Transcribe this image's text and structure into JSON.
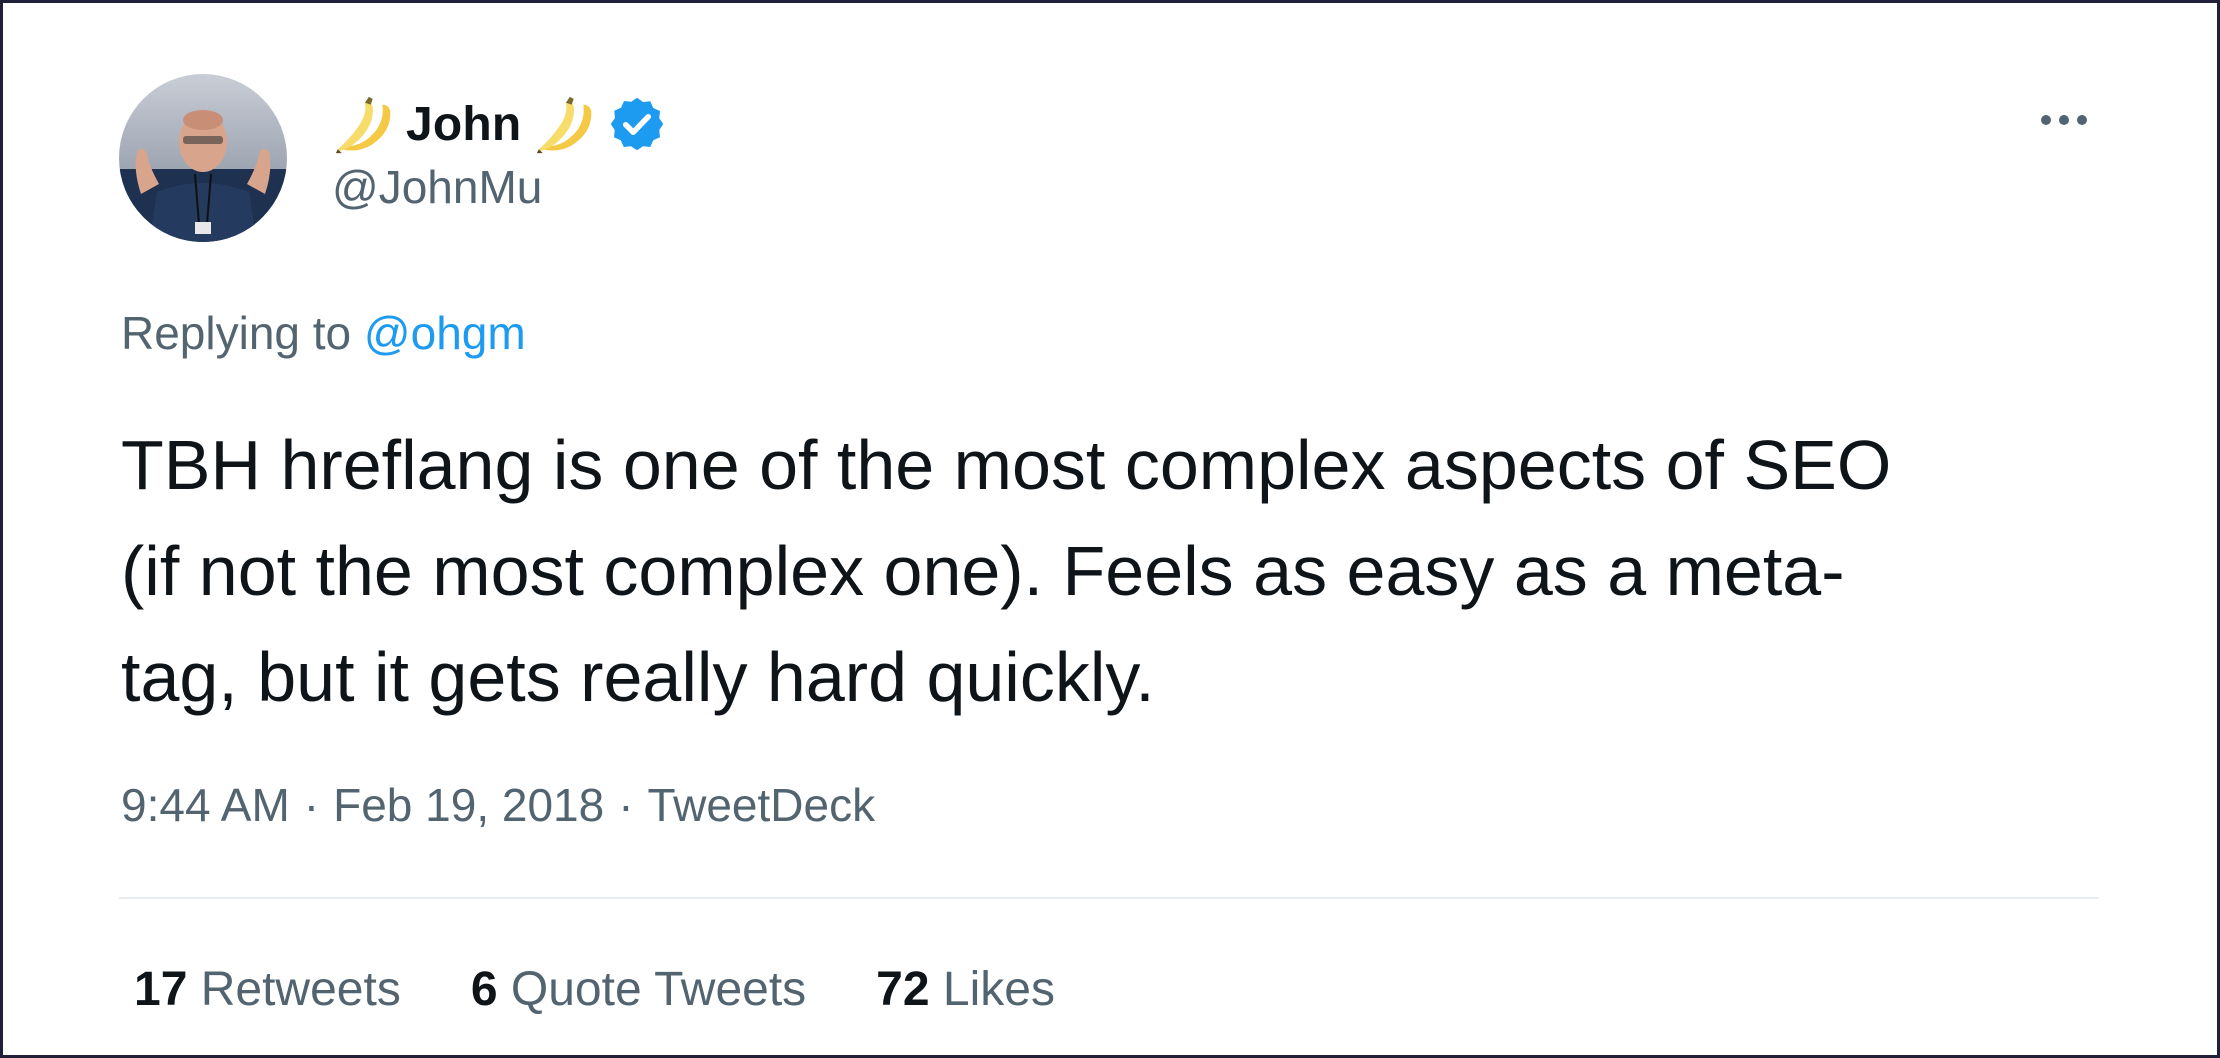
{
  "author": {
    "name": "John",
    "handle": "@JohnMu",
    "name_emoji": "banana-icon",
    "verified": true
  },
  "reply": {
    "prefix": "Replying to",
    "to": "@ohgm"
  },
  "tweet": {
    "text": "TBH hreflang is one of the most complex aspects of SEO\n(if not the most complex one). Feels as easy as a meta-\ntag, but it gets really hard quickly."
  },
  "meta": {
    "time": "9:44 AM",
    "date": "Feb 19, 2018",
    "source": "TweetDeck",
    "sep": "·"
  },
  "stats": {
    "retweets_count": "17",
    "retweets_label": "Retweets",
    "quotes_count": "6",
    "quotes_label": "Quote Tweets",
    "likes_count": "72",
    "likes_label": "Likes"
  },
  "colors": {
    "accent": "#1d9bf0",
    "secondary_text": "#536471",
    "primary_text": "#0f1419",
    "frame": "#20203a"
  }
}
